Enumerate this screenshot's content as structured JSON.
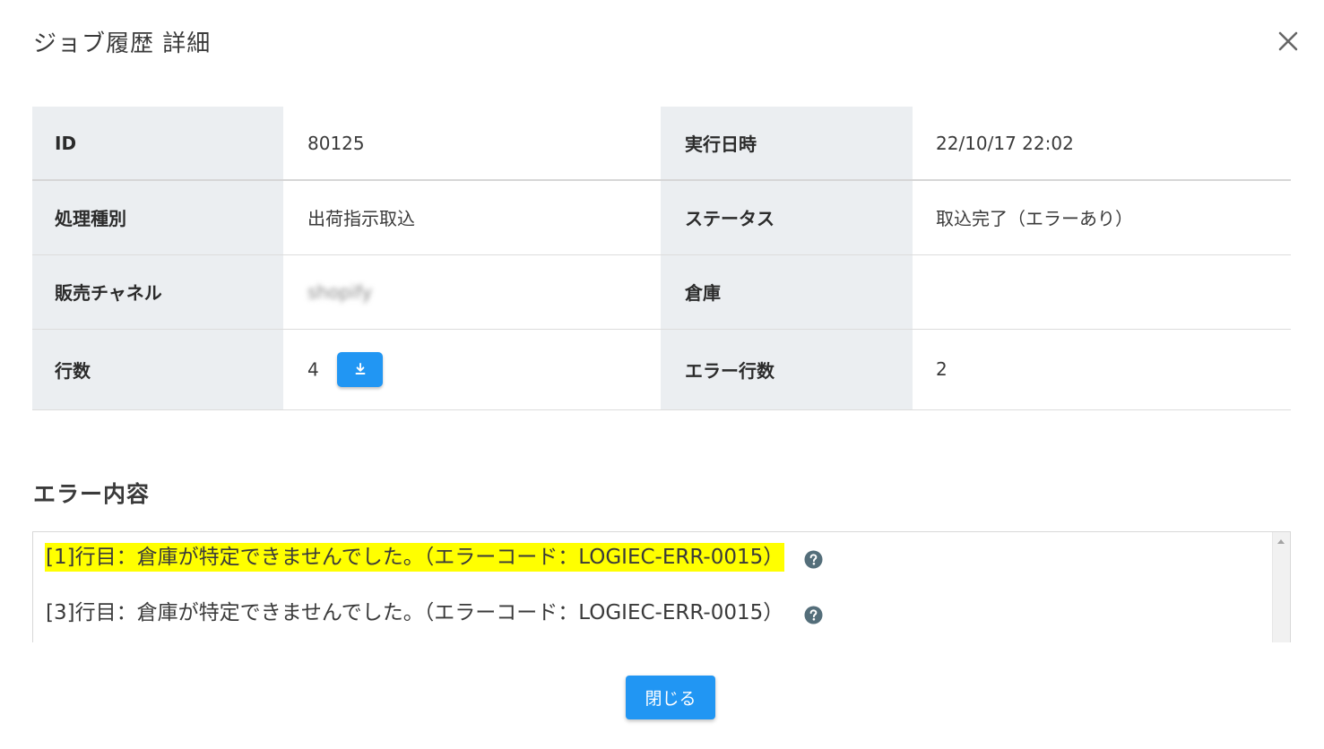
{
  "dialog": {
    "title": "ジョブ履歴 詳細",
    "close_icon": "close-icon"
  },
  "details": {
    "rows": [
      {
        "label1": "ID",
        "value1": "80125",
        "label2": "実行日時",
        "value2": "22/10/17 22:02"
      },
      {
        "label1": "処理種別",
        "value1": "出荷指示取込",
        "label2": "ステータス",
        "value2": "取込完了（エラーあり）"
      },
      {
        "label1": "販売チャネル",
        "value1": "shopify",
        "label2": "倉庫",
        "value2": ""
      },
      {
        "label1": "行数",
        "value1": "4",
        "label2": "エラー行数",
        "value2": "2"
      }
    ],
    "download_icon": "download-icon"
  },
  "errors": {
    "section_title": "エラー内容",
    "items": [
      {
        "text": "[1]行目：倉庫が特定できませんでした。（エラーコード：LOGIEC-ERR-0015）",
        "highlighted": true
      },
      {
        "text": "[3]行目：倉庫が特定できませんでした。（エラーコード：LOGIEC-ERR-0015）",
        "highlighted": false
      }
    ],
    "help_icon": "help-circle-icon"
  },
  "footer": {
    "close_label": "閉じる"
  },
  "colors": {
    "primary": "#2196f3",
    "label_bg": "#ebeef1",
    "highlight": "#ffff00"
  }
}
